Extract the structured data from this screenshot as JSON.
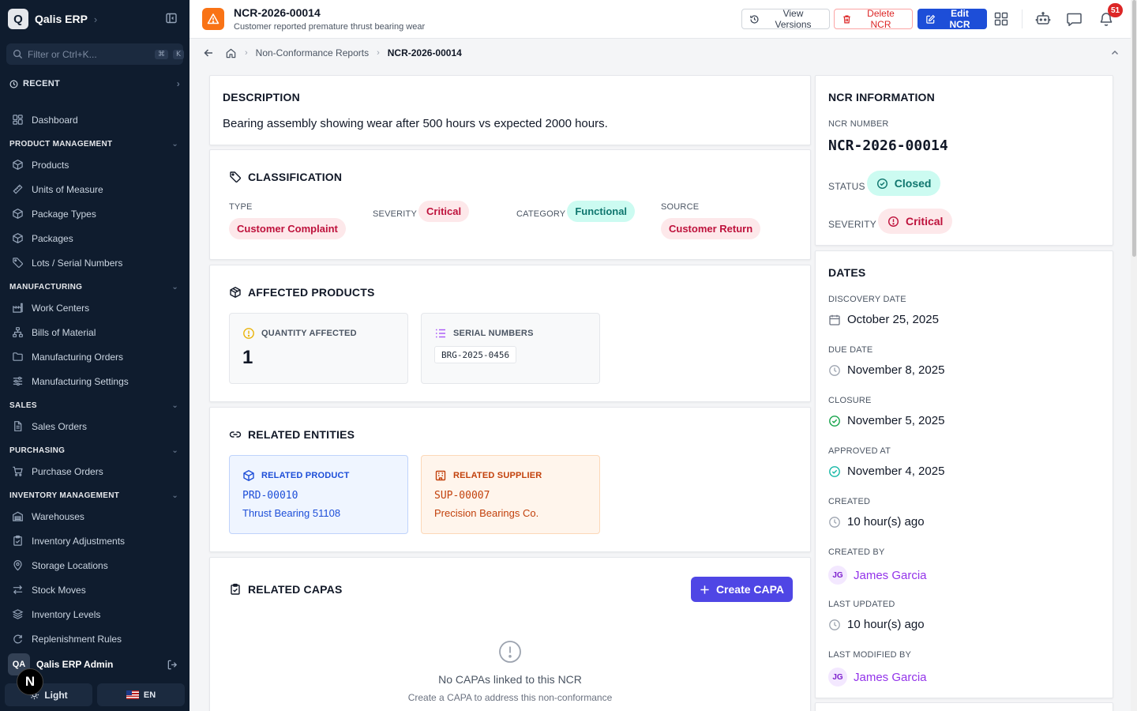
{
  "sidebar": {
    "brand": "Qalis ERP",
    "brand_initial": "Q",
    "search_placeholder": "Filter or Ctrl+K...",
    "search_kbd": [
      "⌘",
      "K"
    ],
    "recent_label": "RECENT",
    "dashboard": "Dashboard",
    "sections": [
      {
        "title": "PRODUCT MANAGEMENT",
        "items": [
          {
            "label": "Products",
            "icon": "box-icon"
          },
          {
            "label": "Units of Measure",
            "icon": "ruler-icon"
          },
          {
            "label": "Package Types",
            "icon": "box-icon"
          },
          {
            "label": "Packages",
            "icon": "box-icon"
          },
          {
            "label": "Lots / Serial Numbers",
            "icon": "tag-icon"
          }
        ]
      },
      {
        "title": "MANUFACTURING",
        "items": [
          {
            "label": "Work Centers",
            "icon": "factory-icon"
          },
          {
            "label": "Bills of Material",
            "icon": "hierarchy-icon"
          },
          {
            "label": "Manufacturing Orders",
            "icon": "folder-icon"
          },
          {
            "label": "Manufacturing Settings",
            "icon": "sliders-icon"
          }
        ]
      },
      {
        "title": "SALES",
        "items": [
          {
            "label": "Sales Orders",
            "icon": "document-icon"
          }
        ]
      },
      {
        "title": "PURCHASING",
        "items": [
          {
            "label": "Purchase Orders",
            "icon": "cart-icon"
          }
        ]
      },
      {
        "title": "INVENTORY MANAGEMENT",
        "items": [
          {
            "label": "Warehouses",
            "icon": "warehouse-icon"
          },
          {
            "label": "Inventory Adjustments",
            "icon": "clipboard-icon"
          },
          {
            "label": "Storage Locations",
            "icon": "map-pin-icon"
          },
          {
            "label": "Stock Moves",
            "icon": "arrows-icon"
          },
          {
            "label": "Inventory Levels",
            "icon": "layers-icon"
          },
          {
            "label": "Replenishment Rules",
            "icon": "refresh-icon"
          }
        ]
      }
    ],
    "user_initials": "QA",
    "user_name": "Qalis ERP Admin",
    "theme_label": "Light",
    "lang_label": "EN"
  },
  "header": {
    "title": "NCR-2026-00014",
    "subtitle": "Customer reported premature thrust bearing wear",
    "view_versions": "View Versions",
    "delete": "Delete NCR",
    "edit": "Edit NCR",
    "notification_count": "51"
  },
  "breadcrumb": {
    "parent": "Non-Conformance Reports",
    "current": "NCR-2026-00014"
  },
  "description": {
    "title": "DESCRIPTION",
    "text": "Bearing assembly showing wear after 500 hours vs expected 2000 hours."
  },
  "classification": {
    "title": "CLASSIFICATION",
    "type_label": "TYPE",
    "type_value": "Customer Complaint",
    "severity_label": "SEVERITY",
    "severity_value": "Critical",
    "category_label": "CATEGORY",
    "category_value": "Functional",
    "source_label": "SOURCE",
    "source_value": "Customer Return"
  },
  "affected": {
    "title": "AFFECTED PRODUCTS",
    "qty_label": "QUANTITY AFFECTED",
    "qty_value": "1",
    "serial_label": "SERIAL NUMBERS",
    "serial_value": "BRG-2025-0456"
  },
  "related": {
    "title": "RELATED ENTITIES",
    "product_label": "RELATED PRODUCT",
    "product_code": "PRD-00010",
    "product_name": "Thrust Bearing 51108",
    "supplier_label": "RELATED SUPPLIER",
    "supplier_code": "SUP-00007",
    "supplier_name": "Precision Bearings Co."
  },
  "capas": {
    "title": "RELATED CAPAS",
    "create": "Create CAPA",
    "empty_title": "No CAPAs linked to this NCR",
    "empty_sub": "Create a CAPA to address this non-conformance"
  },
  "info": {
    "title": "NCR INFORMATION",
    "number_label": "NCR NUMBER",
    "number_value": "NCR-2026-00014",
    "status_label": "STATUS",
    "status_value": "Closed",
    "severity_label": "SEVERITY",
    "severity_value": "Critical"
  },
  "dates": {
    "title": "DATES",
    "discovery_label": "DISCOVERY DATE",
    "discovery_value": "October 25, 2025",
    "due_label": "DUE DATE",
    "due_value": "November 8, 2025",
    "closure_label": "CLOSURE",
    "closure_value": "November 5, 2025",
    "approved_label": "APPROVED AT",
    "approved_value": "November 4, 2025",
    "created_label": "CREATED",
    "created_value": "10 hour(s) ago",
    "created_by_label": "CREATED BY",
    "created_by_initials": "JG",
    "created_by_name": "James Garcia",
    "updated_label": "LAST UPDATED",
    "updated_value": "10 hour(s) ago",
    "modified_by_label": "LAST MODIFIED BY",
    "modified_by_initials": "JG",
    "modified_by_name": "James Garcia"
  },
  "colors": {
    "sidebar_bg": "#0f1c2e",
    "primary": "#1d4ed8",
    "danger": "#dc2626",
    "capa_button": "#4f46e5",
    "ncr_icon": "#f97316"
  }
}
